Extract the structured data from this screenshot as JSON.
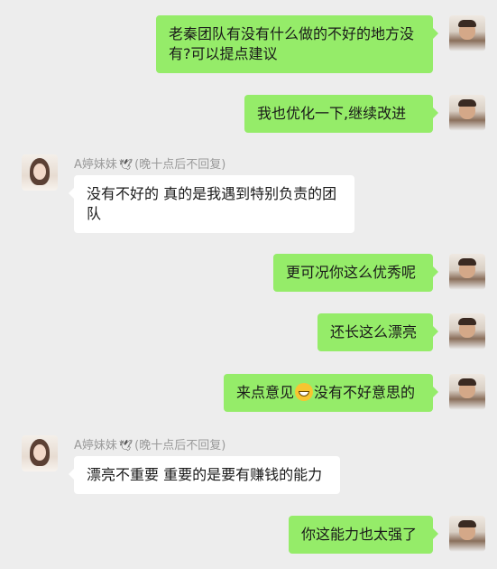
{
  "contact": {
    "name": "A婷妹妹",
    "name_suffix": "(晚十点后不回复)",
    "icon": "dove-icon"
  },
  "messages": [
    {
      "from": "me",
      "text": "老秦团队有没有什么做的不好的地方没有?可以提点建议"
    },
    {
      "from": "me",
      "text": "我也优化一下,继续改进"
    },
    {
      "from": "her",
      "text": "没有不好的 真的是我遇到特别负责的团队"
    },
    {
      "from": "me",
      "text": "更可况你这么优秀呢"
    },
    {
      "from": "me",
      "text": "还长这么漂亮"
    },
    {
      "from": "me",
      "text_before": "来点意见",
      "emoji": "grin-emoji",
      "text_after": "没有不好意思的"
    },
    {
      "from": "her",
      "text": "漂亮不重要 重要的是要有赚钱的能力"
    },
    {
      "from": "me",
      "text": "你这能力也太强了"
    }
  ],
  "colors": {
    "background": "#ededed",
    "my_bubble": "#95ec69",
    "her_bubble": "#ffffff"
  }
}
